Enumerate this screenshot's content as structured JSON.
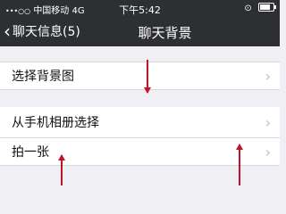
{
  "status_bar": {
    "signal": "•••○○",
    "carrier": "中国移动",
    "network": "4G",
    "time": "下午5:42",
    "battery_level": 0.8
  },
  "nav": {
    "back_label": "聊天信息(5)",
    "title": "聊天背景"
  },
  "list": {
    "choose_background": "选择背景图",
    "from_album": "从手机相册选择",
    "take_photo": "拍一张"
  },
  "annotation_color": "#c0142b"
}
